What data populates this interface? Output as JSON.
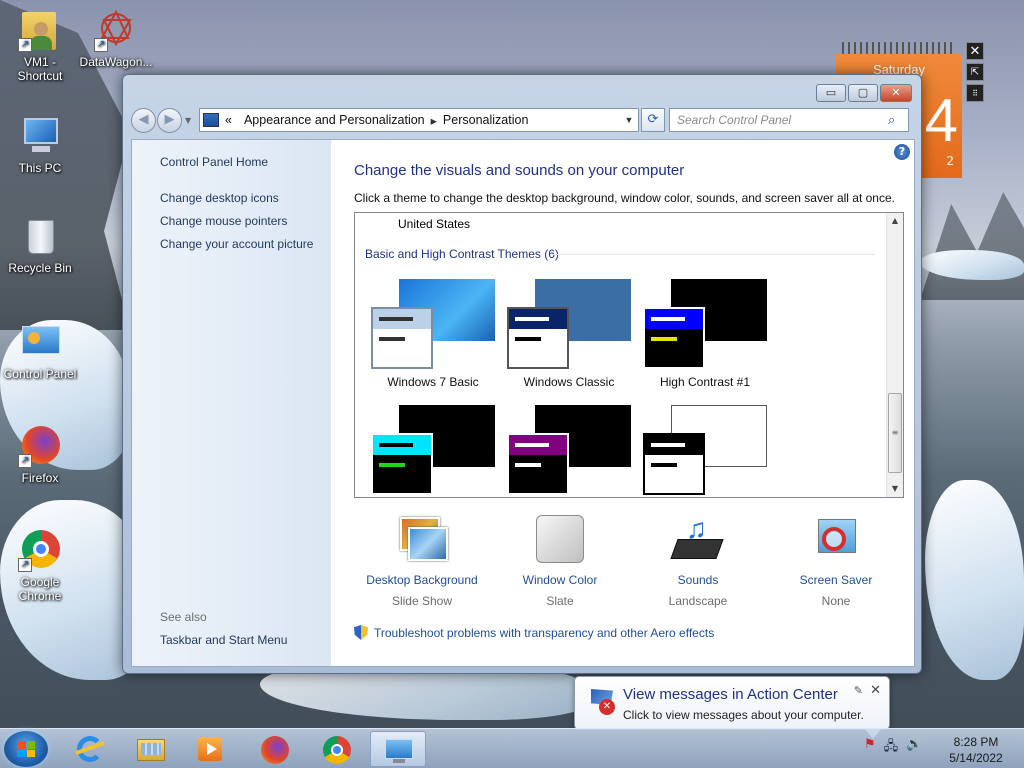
{
  "desktop": {
    "icons": [
      {
        "label": "VM1 - Shortcut"
      },
      {
        "label": "DataWagon..."
      },
      {
        "label": "This PC"
      },
      {
        "label": "Recycle Bin"
      },
      {
        "label": "Control Panel"
      },
      {
        "label": "Firefox"
      },
      {
        "label": "Google Chrome"
      }
    ]
  },
  "gadget": {
    "day": "Saturday",
    "date_fragment": "4",
    "year_fragment": "2"
  },
  "window": {
    "address": {
      "prefix": "«",
      "crumbs": [
        "Appearance and Personalization",
        "Personalization"
      ]
    },
    "search_placeholder": "Search Control Panel",
    "left_links": [
      "Control Panel Home",
      "Change desktop icons",
      "Change mouse pointers",
      "Change your account picture"
    ],
    "see_also_label": "See also",
    "see_also_links": [
      "Taskbar and Start Menu"
    ],
    "title": "Change the visuals and sounds on your computer",
    "description": "Click a theme to change the desktop background, window color, sounds, and screen saver all at once.",
    "themes_list": {
      "prev_item": "United States",
      "group_label": "Basic and High Contrast Themes (6)",
      "themes": [
        "Windows 7 Basic",
        "Windows Classic",
        "High Contrast #1",
        "",
        "",
        ""
      ]
    },
    "bottom_items": [
      {
        "title": "Desktop Background",
        "value": "Slide Show",
        "icon": "desktop-background-icon"
      },
      {
        "title": "Window Color",
        "value": "Slate",
        "icon": "window-color-icon"
      },
      {
        "title": "Sounds",
        "value": "Landscape",
        "icon": "sounds-icon"
      },
      {
        "title": "Screen Saver",
        "value": "None",
        "icon": "screen-saver-icon"
      }
    ],
    "troubleshoot_link": "Troubleshoot problems with transparency and other Aero effects"
  },
  "notification": {
    "title": "View messages in Action Center",
    "text": "Click to view messages about your computer."
  },
  "taskbar": {
    "time": "8:28 PM",
    "date": "5/14/2022"
  }
}
